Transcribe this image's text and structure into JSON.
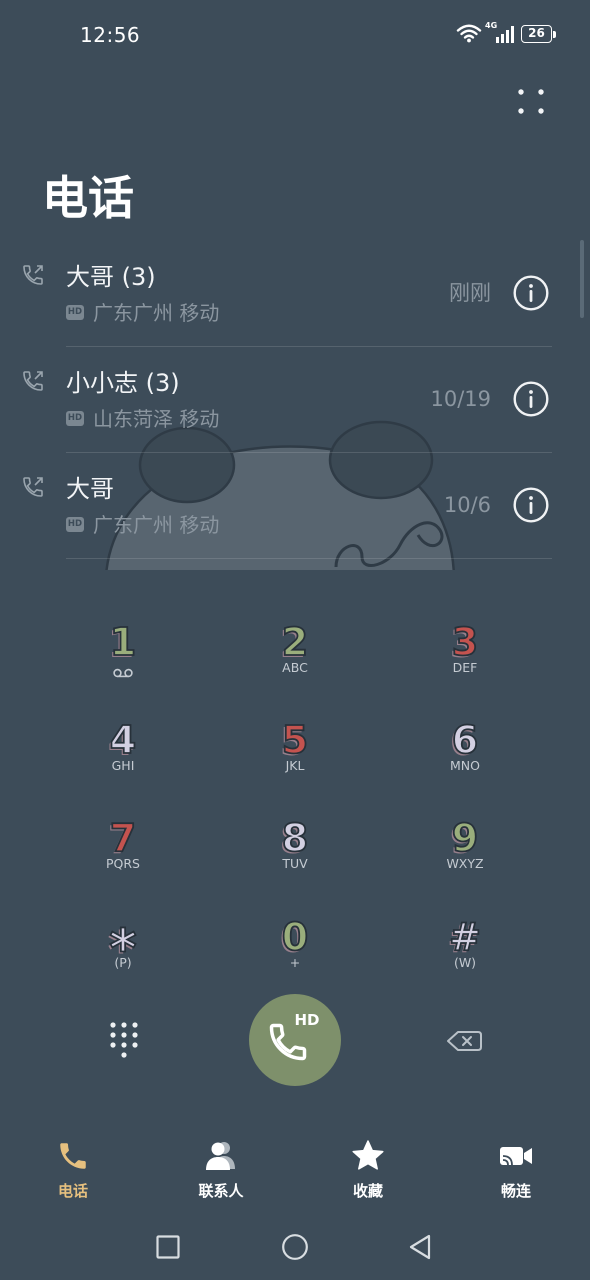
{
  "status_bar": {
    "time": "12:56",
    "network_type": "4G",
    "battery_level": "26",
    "wifi_icon": "wifi-icon",
    "signal_icon": "signal-icon",
    "battery_icon": "battery-icon"
  },
  "header": {
    "title": "电话",
    "more_icon": "more-dots-icon"
  },
  "call_log": [
    {
      "name": "大哥 (3)",
      "badge": "HD",
      "location": "广东广州 移动",
      "time": "刚刚",
      "icon": "outgoing-call-icon"
    },
    {
      "name": "小小志 (3)",
      "badge": "HD",
      "location": "山东菏泽 移动",
      "time": "10/19",
      "icon": "outgoing-call-icon"
    },
    {
      "name": "大哥",
      "badge": "HD",
      "location": "广东广州 移动",
      "time": "10/6",
      "icon": "outgoing-call-icon"
    }
  ],
  "dialpad": {
    "keys": [
      {
        "digit": "1",
        "sub_icon": "voicemail-icon",
        "color": "#9aae7c"
      },
      {
        "digit": "2",
        "sub": "ABC",
        "color": "#9aae7c"
      },
      {
        "digit": "3",
        "sub": "DEF",
        "color": "#c4534f"
      },
      {
        "digit": "4",
        "sub": "GHI",
        "color": "#d3d0e2"
      },
      {
        "digit": "5",
        "sub": "JKL",
        "color": "#c4534f"
      },
      {
        "digit": "6",
        "sub": "MNO",
        "color": "#d3d0e2"
      },
      {
        "digit": "7",
        "sub": "PQRS",
        "color": "#c4534f"
      },
      {
        "digit": "8",
        "sub": "TUV",
        "color": "#d3d0e2"
      },
      {
        "digit": "9",
        "sub": "WXYZ",
        "color": "#9aae7c"
      },
      {
        "digit": "*",
        "sub": "(P)",
        "color": "#d3d0e2"
      },
      {
        "digit": "0",
        "sub": "+",
        "color": "#9aae7c"
      },
      {
        "digit": "#",
        "sub": "(W)",
        "color": "#d3d0e2"
      }
    ]
  },
  "actions": {
    "dialpad_toggle_icon": "dialpad-grid-icon",
    "call_button_badge": "HD",
    "call_icon": "phone-icon",
    "backspace_icon": "backspace-icon"
  },
  "bottom_nav": [
    {
      "label": "电话",
      "icon": "phone-icon",
      "active": true
    },
    {
      "label": "联系人",
      "icon": "contacts-icon",
      "active": false
    },
    {
      "label": "收藏",
      "icon": "star-icon",
      "active": false
    },
    {
      "label": "畅连",
      "icon": "video-call-icon",
      "active": false
    }
  ],
  "system_nav": {
    "recent_icon": "recent-apps-icon",
    "home_icon": "home-icon",
    "back_icon": "back-icon"
  },
  "colors": {
    "background": "#3d4c59",
    "primary_text": "#f2f4f6",
    "secondary_text": "#8b96a0",
    "accent": "#e6c07f",
    "call_button": "#7e906b"
  }
}
